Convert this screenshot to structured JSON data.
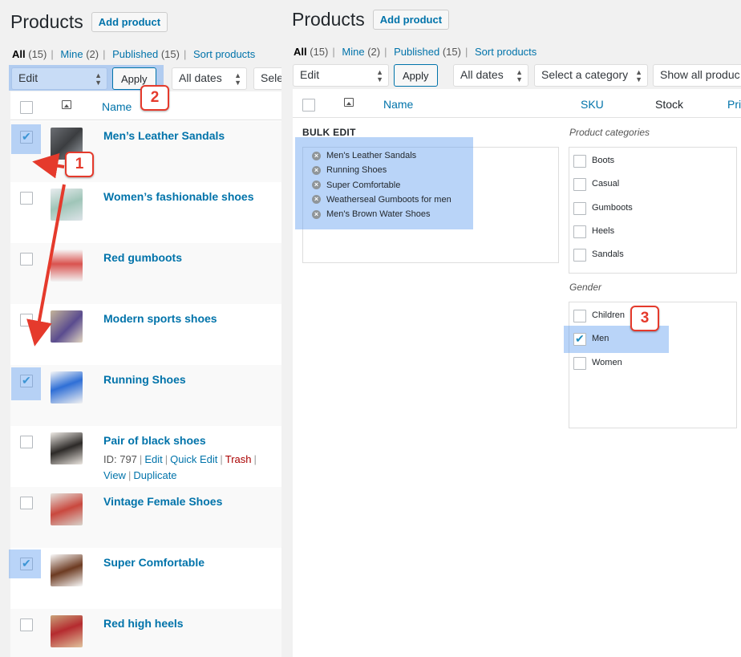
{
  "left": {
    "title": "Products",
    "add_product": "Add product",
    "views": [
      {
        "label": "All",
        "count": "(15)"
      },
      {
        "label": "Mine",
        "count": "(2)"
      },
      {
        "label": "Published",
        "count": "(15)"
      },
      {
        "label": "Sort products",
        "count": ""
      }
    ],
    "bulk_action": "Edit",
    "apply": "Apply",
    "date_filter": "All dates",
    "category_filter": "Sele",
    "col_name": "Name",
    "rows": [
      {
        "name": "Men’s Leather Sandals",
        "checked": true
      },
      {
        "name": "Women’s fashionable shoes",
        "checked": false
      },
      {
        "name": "Red gumboots",
        "checked": false
      },
      {
        "name": "Modern sports shoes",
        "checked": false
      },
      {
        "name": "Running Shoes",
        "checked": true
      },
      {
        "name": "Pair of black shoes",
        "checked": false
      },
      {
        "name": "Vintage Female Shoes",
        "checked": false
      },
      {
        "name": "Super Comfortable",
        "checked": true
      },
      {
        "name": "Red high heels",
        "checked": false
      }
    ],
    "row_actions": {
      "id": "ID: 797",
      "edit": "Edit",
      "quick_edit": "Quick Edit",
      "trash": "Trash",
      "view": "View",
      "duplicate": "Duplicate"
    }
  },
  "right": {
    "title": "Products",
    "add_product": "Add product",
    "views": [
      {
        "label": "All",
        "count": "(15)"
      },
      {
        "label": "Mine",
        "count": "(2)"
      },
      {
        "label": "Published",
        "count": "(15)"
      },
      {
        "label": "Sort products",
        "count": ""
      }
    ],
    "bulk_action": "Edit",
    "apply": "Apply",
    "date_filter": "All dates",
    "category_filter": "Select a category",
    "stock_filter": "Show all produc",
    "col_name": "Name",
    "col_sku": "SKU",
    "col_stock": "Stock",
    "col_price": "Pri",
    "bulk_edit_label": "BULK EDIT",
    "bulk_titles": [
      "Men's Leather Sandals",
      "Running Shoes",
      "Super Comfortable",
      "Weatherseal Gumboots for men",
      "Men's Brown Water Shoes"
    ],
    "categories_label": "Product categories",
    "categories": [
      "Boots",
      "Casual",
      "Gumboots",
      "Heels",
      "Sandals"
    ],
    "gender_label": "Gender",
    "genders": [
      {
        "label": "Children",
        "checked": false
      },
      {
        "label": "Men",
        "checked": true
      },
      {
        "label": "Women",
        "checked": false
      }
    ]
  },
  "badges": [
    "1",
    "2",
    "3"
  ],
  "colors": {
    "accent": "#0073aa",
    "highlight": "#64a0f0",
    "badge": "#e53a2c",
    "trash": "#aa0000"
  }
}
